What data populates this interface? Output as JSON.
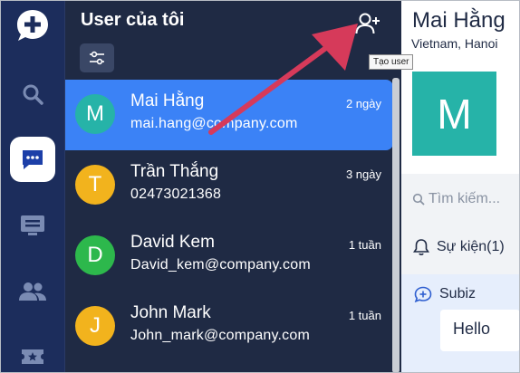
{
  "rail": {
    "items": [
      "logo-icon",
      "search-icon",
      "chat-icon",
      "list-icon",
      "users-icon",
      "ticket-icon"
    ],
    "active": "chat-icon"
  },
  "list": {
    "title": "User của tôi",
    "add_user_tooltip": "Tạo user",
    "users": [
      {
        "initial": "M",
        "name": "Mai Hằng",
        "sub": "mai.hang@company.com",
        "time": "2 ngày",
        "color": "#26b3a8",
        "selected": true
      },
      {
        "initial": "T",
        "name": "Trần Thắng",
        "sub": "02473021368",
        "time": "3 ngày",
        "color": "#f2b31d",
        "selected": false
      },
      {
        "initial": "D",
        "name": "David Kem",
        "sub": "David_kem@company.com",
        "time": "1 tuần",
        "color": "#2db84c",
        "selected": false
      },
      {
        "initial": "J",
        "name": "John Mark",
        "sub": "John_mark@company.com",
        "time": "1 tuần",
        "color": "#f2b31d",
        "selected": false
      }
    ]
  },
  "detail": {
    "name": "Mai Hằng",
    "location": "Vietnam, Hanoi",
    "avatar_initial": "M",
    "search_placeholder": "Tìm kiếm...",
    "events_label": "Sự kiện(1)",
    "channel_label": "Subiz",
    "message": "Hello"
  },
  "colors": {
    "accent": "#3b82f6",
    "sidebar": "#1c2d5c",
    "list_bg": "#1f2a44",
    "arrow": "#d63a5a"
  }
}
